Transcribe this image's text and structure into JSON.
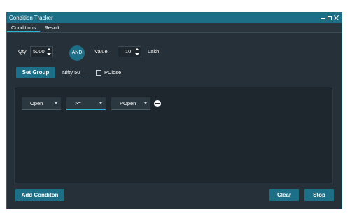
{
  "window": {
    "title": "Condition Tracker"
  },
  "tabs": [
    {
      "label": "Conditions",
      "active": true
    },
    {
      "label": "Result",
      "active": false
    }
  ],
  "filters": {
    "qty_label": "Qty",
    "qty_value": "5000",
    "logic_operator": "AND",
    "value_label": "Value",
    "value_value": "10",
    "value_unit": "Lakh"
  },
  "group": {
    "set_group_label": "Set Group",
    "group_name": "Nifty 50",
    "pclose_label": "PClose",
    "pclose_checked": false
  },
  "conditions": [
    {
      "field": "Open",
      "operator": ">=",
      "compare_to": "POpen"
    }
  ],
  "footer": {
    "add_condition_label": "Add Conditon",
    "clear_label": "Clear",
    "stop_label": "Stop"
  },
  "colors": {
    "accent": "#1c6f86",
    "background": "#253038",
    "panel": "#1e272d"
  }
}
